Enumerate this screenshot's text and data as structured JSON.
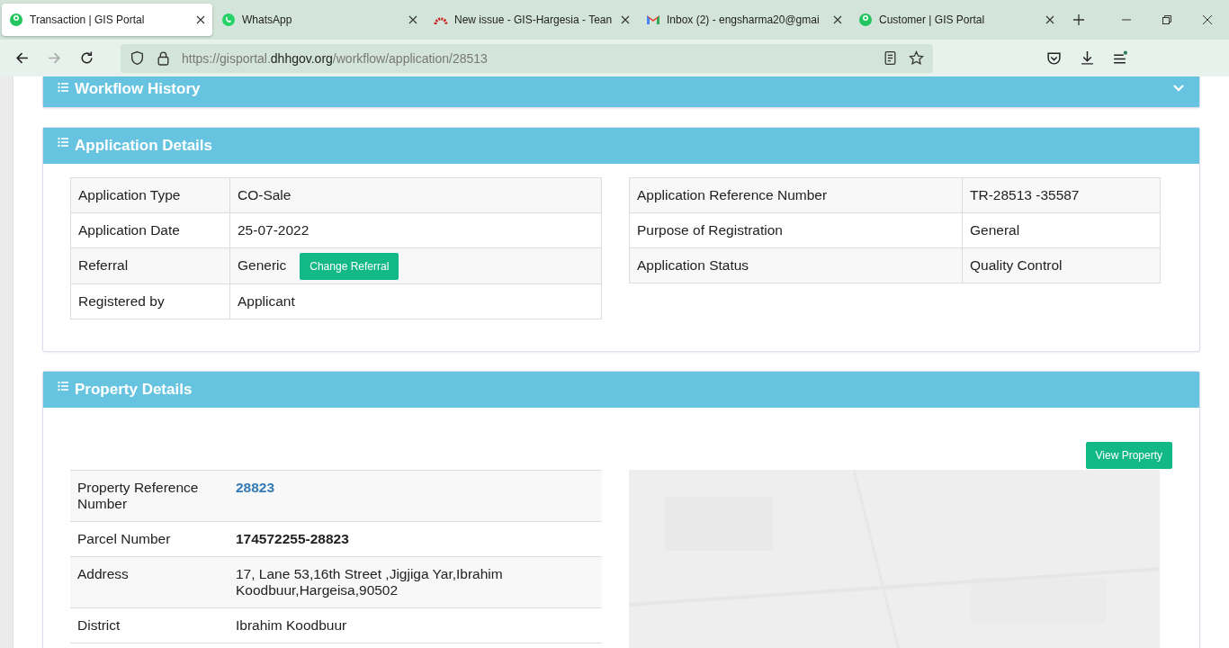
{
  "browser": {
    "tabs": [
      {
        "title": "Transaction | GIS Portal",
        "kind": "portal",
        "selected": true
      },
      {
        "title": "WhatsApp",
        "kind": "chat",
        "selected": false
      },
      {
        "title": "New issue - GIS-Hargesia - Tean",
        "kind": "arc",
        "selected": false
      },
      {
        "title": "Inbox (2) - engsharma20@gmai",
        "kind": "mail",
        "selected": false
      },
      {
        "title": "Customer | GIS Portal",
        "kind": "portal",
        "selected": false
      }
    ],
    "url": {
      "prefix": "https://gisportal.",
      "domain": "dhhgov.org",
      "path": "/workflow/application/28513"
    }
  },
  "workflow_history": {
    "title": "Workflow History",
    "expanded": false
  },
  "application_details": {
    "title": "Application Details",
    "left": [
      {
        "label": "Application Type",
        "value": "CO-Sale"
      },
      {
        "label": "Application Date",
        "value": "25-07-2022"
      },
      {
        "label": "Referral",
        "value": "Generic",
        "button": "Change Referral"
      },
      {
        "label": "Registered by",
        "value": "Applicant"
      }
    ],
    "right": [
      {
        "label": "Application Reference Number",
        "value": "TR-28513 -35587"
      },
      {
        "label": "Purpose of Registration",
        "value": "General"
      },
      {
        "label": "Application Status",
        "value": "Quality Control"
      }
    ]
  },
  "property_details": {
    "title": "Property Details",
    "view_button": "View Property",
    "rows": [
      {
        "label": "Property Reference Number",
        "value": "28823",
        "kind": "link"
      },
      {
        "label": "Parcel Number",
        "value": "174572255-28823",
        "kind": "bold"
      },
      {
        "label": "Address",
        "value": "17, Lane 53,16th Street ,Jigjiga Yar,Ibrahim Koodbuur,Hargeisa,90502",
        "kind": "text"
      },
      {
        "label": "District",
        "value": "Ibrahim Koodbuur",
        "kind": "text"
      }
    ]
  }
}
